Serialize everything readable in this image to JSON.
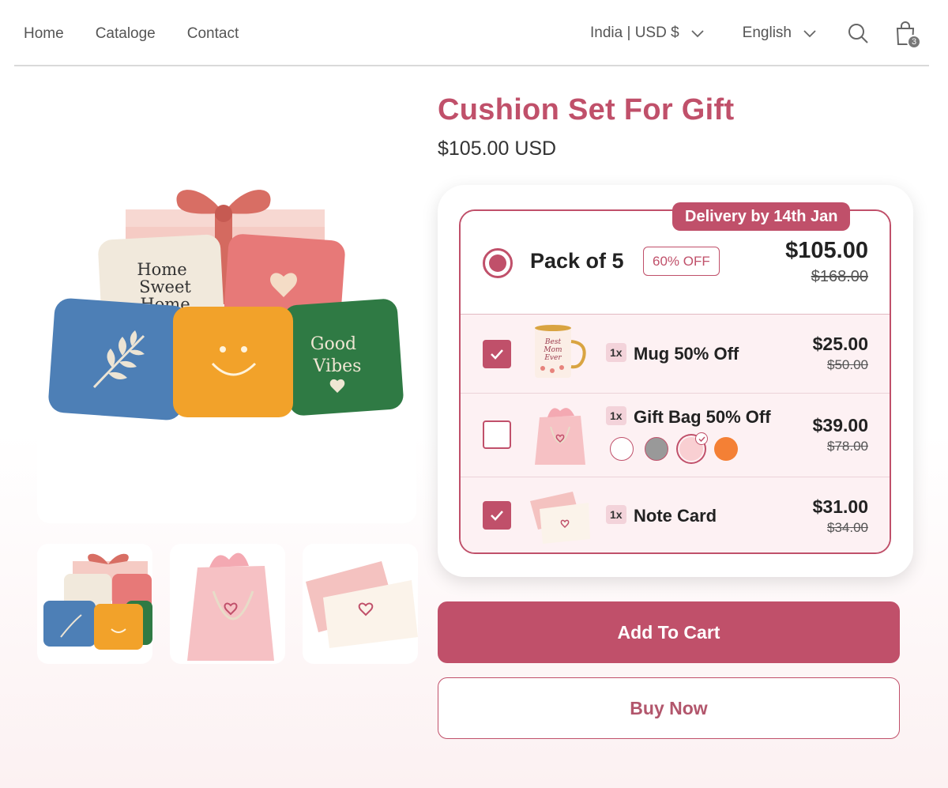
{
  "nav": {
    "home": "Home",
    "catalog": "Cataloge",
    "contact": "Contact"
  },
  "header": {
    "country_currency": "India | USD $",
    "language": "English",
    "cart_count": "3"
  },
  "product": {
    "title": "Cushion Set For Gift",
    "price": "$105.00 USD"
  },
  "bundle": {
    "delivery_badge": "Delivery by 14th Jan",
    "pack_label": "Pack of 5",
    "discount_badge": "60% OFF",
    "pack_price": "$105.00",
    "pack_old_price": "$168.00",
    "items": [
      {
        "qty": "1x",
        "name": "Mug 50% Off",
        "price": "$25.00",
        "old_price": "$50.00",
        "checked": true
      },
      {
        "qty": "1x",
        "name": "Gift Bag 50% Off",
        "price": "$39.00",
        "old_price": "$78.00",
        "checked": false,
        "swatches": [
          "#ffffff",
          "#999999",
          "#f9cfd2",
          "#f48035"
        ],
        "selected_swatch": 2
      },
      {
        "qty": "1x",
        "name": "Note Card",
        "price": "$31.00",
        "old_price": "$34.00",
        "checked": true
      }
    ]
  },
  "actions": {
    "add_to_cart": "Add To Cart",
    "buy_now": "Buy Now"
  },
  "thumbnails": [
    "cushion-set-thumbnail",
    "gift-bag-thumbnail",
    "note-card-thumbnail"
  ],
  "main_image_text": {
    "pillow_1": "Home Sweet Home",
    "pillow_2": "Good Vibes"
  },
  "mug_text": "Best Mom Ever",
  "colors": {
    "accent": "#c0506a",
    "text": "#222222"
  }
}
